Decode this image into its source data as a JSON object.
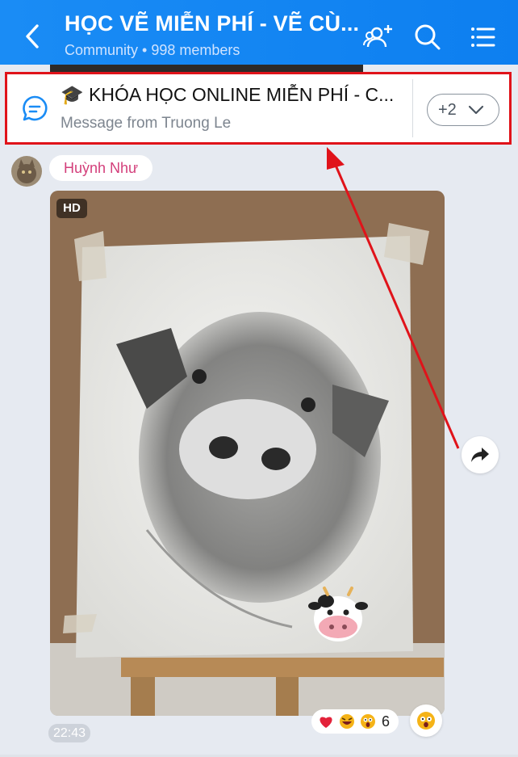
{
  "header": {
    "title": "HỌC VẼ MIỄN PHÍ - VẼ CÙ...",
    "subtitle_type": "Community",
    "subtitle_sep": "•",
    "subtitle_members": "998 members",
    "icons": [
      "back-icon",
      "add-member-icon",
      "search-icon",
      "menu-list-icon"
    ]
  },
  "pinned": {
    "title": "🎓 KHÓA HỌC ONLINE MIỄN PHÍ - C...",
    "subtitle": "Message from Truong Le",
    "more_label": "+2",
    "accent": "#e0131a"
  },
  "message": {
    "sender": "Huỳnh Như",
    "badge": "HD",
    "time": "22:43",
    "reactions": {
      "icons": [
        "heart",
        "laugh",
        "wow"
      ],
      "count": "6"
    }
  },
  "colors": {
    "header": "#1a8cf5",
    "sender": "#d33e7a",
    "background": "#e6eaf1"
  }
}
